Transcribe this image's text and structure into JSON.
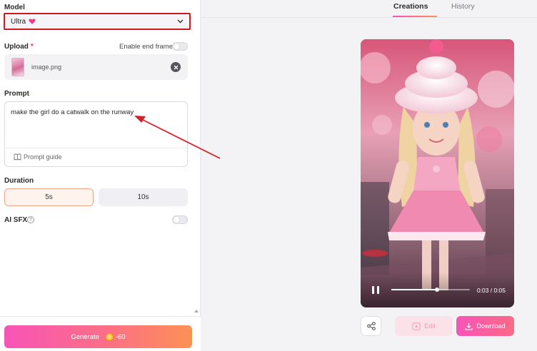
{
  "left_panel": {
    "model": {
      "label": "Model",
      "value": "Ultra"
    },
    "upload": {
      "label": "Upload",
      "required_mark": "*",
      "end_frame_label": "Enable end frame",
      "file_name": "image.png"
    },
    "prompt": {
      "label": "Prompt",
      "text": "make the girl do a catwalk on the runway",
      "guide_label": "Prompt guide"
    },
    "duration": {
      "label": "Duration",
      "options": [
        "5s",
        "10s"
      ],
      "selected": "5s"
    },
    "ai_sfx": {
      "label": "AI SFX",
      "help": "?"
    },
    "generate": {
      "label": "Generate",
      "cost": "-60"
    }
  },
  "tabs": [
    {
      "label": "Creations",
      "active": true
    },
    {
      "label": "History",
      "active": false
    }
  ],
  "player": {
    "time": "0:03 / 0:05",
    "progress": 0.6
  },
  "actions": {
    "edit_label": "Edit",
    "download_label": "Download"
  },
  "colors": {
    "accent_pink": "#f754b7",
    "accent_orange": "#fd9154",
    "highlight_red": "#d0191f"
  }
}
